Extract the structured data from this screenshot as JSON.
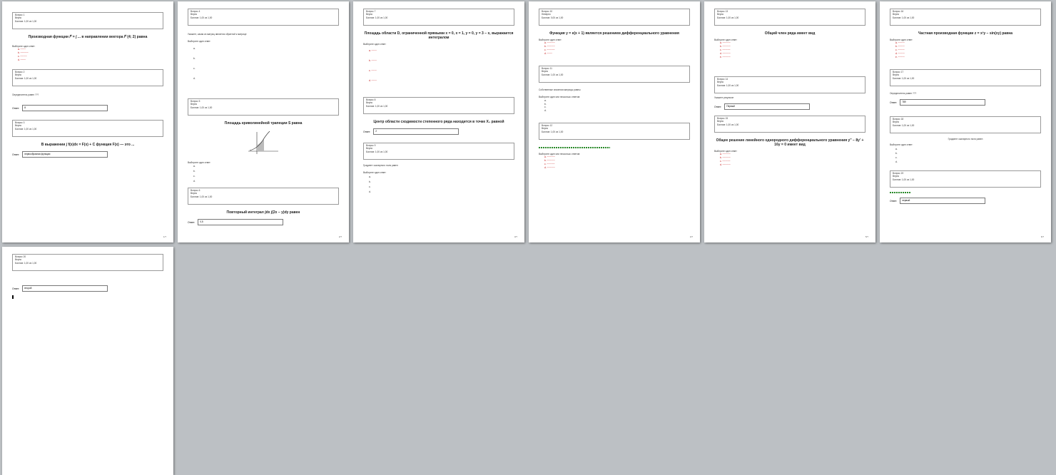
{
  "pages": [
    {
      "page_label": "1/7",
      "questions": [
        {
          "n": "Вопрос 1",
          "a": "Верно",
          "b": "Баллов: 1,00 из 1,00",
          "title": "Производная функции 𝐹 = ∫ ... в направлении вектора 𝐹 (4; 2) равна",
          "prompt": "Выберите один ответ:",
          "options": [
            "a.",
            "b.",
            "c.",
            "d."
          ]
        },
        {
          "n": "Вопрос 2",
          "a": "Верно",
          "b": "Баллов: 1,00 из 1,00",
          "title": "Определитель",
          "prompt": "равен ???",
          "answer_label": "Ответ:",
          "answer": "8"
        },
        {
          "n": "Вопрос 3",
          "a": "Верно",
          "b": "Баллов: 1,00 из 1,00",
          "title": "В выражении ∫ f(x)dx = F(x) + C функция F(x) — это ...",
          "answer_label": "Ответ:",
          "answer": "первообразная функции"
        }
      ]
    },
    {
      "page_label": "2/7",
      "questions": [
        {
          "n": "Вопрос 4",
          "a": "Верно",
          "b": "Баллов: 1,00 из 1,00",
          "title": "Укажите, какая из матриц является обратной к матрице",
          "prompt": "Выберите один ответ:",
          "options": [
            "a.",
            "b.",
            "c.",
            "d."
          ]
        },
        {
          "n": "Вопрос 5",
          "a": "Верно",
          "b": "Баллов: 1,00 из 1,00",
          "title": "Площадь криволинейной трапеции S равна",
          "prompt": "Выберите один ответ:",
          "options": [
            "a.",
            "b.",
            "c.",
            "d."
          ]
        },
        {
          "n": "Вопрос 6",
          "a": "Верно",
          "b": "Баллов: 1,00 из 1,00",
          "title": "Повторный интеграл ∫dx ∫(2x − y)dy равен",
          "answer_label": "Ответ:",
          "answer": "0,5"
        }
      ]
    },
    {
      "page_label": "3/7",
      "questions": [
        {
          "n": "Вопрос 7",
          "a": "Верно",
          "b": "Баллов: 1,00 из 1,00",
          "title": "Площадь области D, ограниченной прямыми x = 0, x = 1, y = 0, y = 3 − x, выражается интегралом",
          "prompt": "Выберите один ответ:",
          "options": [
            "a.",
            "b.",
            "c.",
            "d."
          ]
        },
        {
          "n": "Вопрос 8",
          "a": "Верно",
          "b": "Баллов: 1,00 из 1,00",
          "title": "Центр области сходимости степенного ряда находится в точке X₀ равной",
          "answer_label": "Ответ:",
          "answer": "2"
        },
        {
          "n": "Вопрос 9",
          "a": "Верно",
          "b": "Баллов: 1,00 из 1,00",
          "title": "Градиент скалярного поля равен",
          "prompt": "Выберите один ответ:",
          "options": [
            "a.",
            "b.",
            "c.",
            "d."
          ]
        }
      ]
    },
    {
      "page_label": "4/7",
      "questions": [
        {
          "n": "Вопрос 10",
          "a": "Неверно",
          "b": "Баллов: 0,00 из 1,00",
          "title": "Функция y = e(x + 1) является решением дифференциального уравнения",
          "prompt": "Выберите один ответ:",
          "options": [
            "a.",
            "b.",
            "c.",
            "d."
          ]
        },
        {
          "n": "Вопрос 11",
          "a": "Верно",
          "b": "Баллов: 1,00 из 1,00",
          "title": "Собственные значения матрицы равны",
          "prompt": "Выберите один или несколько ответов:",
          "options": [
            "a.",
            "b.",
            "c.",
            "d."
          ]
        },
        {
          "n": "Вопрос 12",
          "a": "Верно",
          "b": "Баллов: 1,00 из 1,00",
          "title": "",
          "prompt": "Выберите один или несколько ответов:",
          "options": [
            "a.",
            "b.",
            "c.",
            "d."
          ]
        }
      ]
    },
    {
      "page_label": "5/7",
      "questions": [
        {
          "n": "Вопрос 13",
          "a": "Верно",
          "b": "Баллов: 1,00 из 1,00",
          "title": "Общий член ряда имеет вид",
          "prompt": "Выберите один ответ:",
          "options": [
            "a.",
            "b.",
            "c.",
            "d.",
            "e."
          ]
        },
        {
          "n": "Вопрос 14",
          "a": "Верно",
          "b": "Баллов: 1,00 из 1,00",
          "title": "Укажите результат",
          "answer_label": "Ответ:",
          "answer": "Первый"
        },
        {
          "n": "Вопрос 15",
          "a": "Верно",
          "b": "Баллов: 1,00 из 1,00",
          "title": "Общее решение линейного однородного дифференциального уравнения y'' − 8y' + 16y = 0 имеет вид",
          "prompt": "Выберите один ответ:",
          "options": [
            "a.",
            "b.",
            "c.",
            "d."
          ]
        }
      ]
    },
    {
      "page_label": "6/7",
      "questions": [
        {
          "n": "Вопрос 16",
          "a": "Верно",
          "b": "Баллов: 1,00 из 1,00",
          "title": "Частная производная функции z = x²y − sin(xy) равна",
          "prompt": "Выберите один ответ:",
          "options": [
            "a.",
            "b.",
            "c.",
            "d.",
            "e."
          ]
        },
        {
          "n": "Вопрос 17",
          "a": "Верно",
          "b": "Баллов: 1,00 из 1,00",
          "title": "Определитель равен ???",
          "answer_label": "Ответ:",
          "answer": "789"
        },
        {
          "n": "Вопрос 18",
          "a": "Верно",
          "b": "Баллов: 1,00 из 1,00",
          "title": "Градиент скалярного поля равен",
          "prompt": "Выберите один ответ:",
          "options": [
            "a.",
            "b.",
            "c.",
            "d."
          ]
        },
        {
          "n": "Вопрос 19",
          "a": "Верно",
          "b": "Баллов: 1,00 из 1,00",
          "title": "",
          "answer_label": "Ответ:",
          "answer": "первый"
        }
      ]
    },
    {
      "page_label": "7/7",
      "questions": [
        {
          "n": "Вопрос 20",
          "a": "Верно",
          "b": "Баллов: 1,00 из 1,00",
          "title": "",
          "answer_label": "Ответ:",
          "answer": "второй"
        }
      ]
    }
  ]
}
